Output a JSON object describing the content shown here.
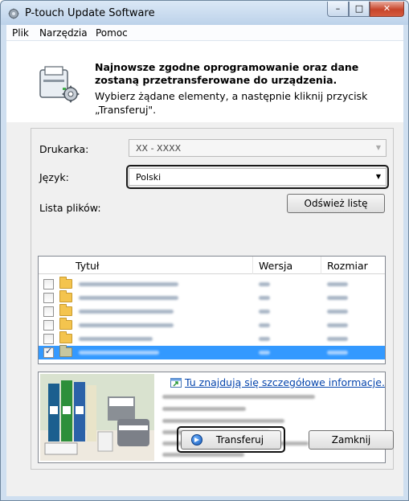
{
  "window": {
    "title": "P-touch Update Software"
  },
  "menu": {
    "items": [
      "Plik",
      "Narzędzia",
      "Pomoc"
    ]
  },
  "header": {
    "bold_line1": "Najnowsze zgodne oprogramowanie oraz dane",
    "bold_line2": "zostaną przetransferowane do urządzenia.",
    "line3": "Wybierz żądane elementy, a następnie kliknij przycisk",
    "line4": "„Transferuj\"."
  },
  "form": {
    "printer_label": "Drukarka:",
    "printer_value": "XX - XXXX",
    "language_label": "Język:",
    "language_value": "Polski",
    "file_list_label": "Lista plików:",
    "refresh_button": "Odśwież listę"
  },
  "file_list": {
    "columns": [
      "Tytuł",
      "Wersja",
      "Rozmiar"
    ],
    "rows": [
      {
        "checked": false,
        "selected": false
      },
      {
        "checked": false,
        "selected": false
      },
      {
        "checked": false,
        "selected": false
      },
      {
        "checked": false,
        "selected": false
      },
      {
        "checked": false,
        "selected": false
      },
      {
        "checked": true,
        "selected": true
      }
    ]
  },
  "info": {
    "link_text": "Tu znajdują się szczegółowe informacje."
  },
  "buttons": {
    "transfer": "Transferuj",
    "close": "Zamknij"
  },
  "icons": {
    "app": "gear-icon",
    "printer": "printer-settings-icon",
    "info_link": "info-window-icon",
    "transfer": "arrow-circle-icon"
  },
  "colors": {
    "selection": "#3399ff",
    "link": "#0645ad"
  }
}
